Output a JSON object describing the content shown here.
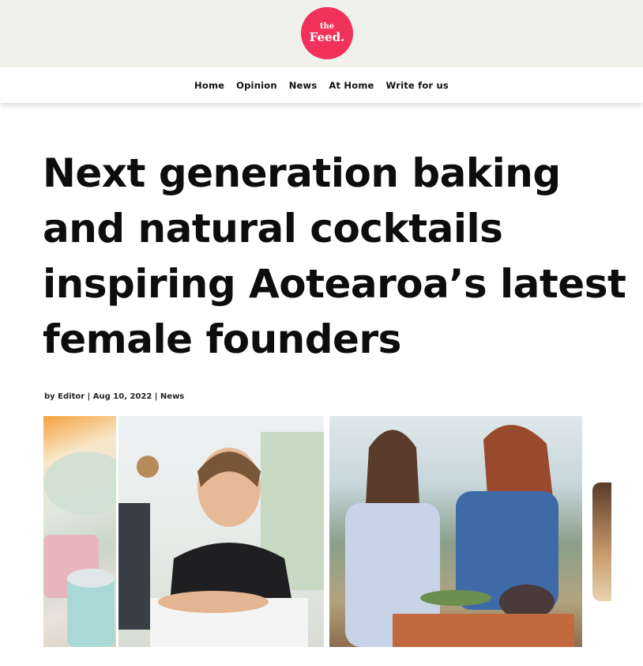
{
  "logo": {
    "line1": "the",
    "line2": "Feed."
  },
  "nav": {
    "items": [
      {
        "label": "Home"
      },
      {
        "label": "Opinion"
      },
      {
        "label": "News"
      },
      {
        "label": "At Home"
      },
      {
        "label": "Write for us"
      }
    ]
  },
  "article": {
    "title": "Next generation baking and natural cocktails inspiring Aotearoa’s latest female founders",
    "meta": "by Editor | Aug 10, 2022 | News"
  },
  "colors": {
    "brand": "#f0325a",
    "header_bg": "#f0f1ea"
  }
}
